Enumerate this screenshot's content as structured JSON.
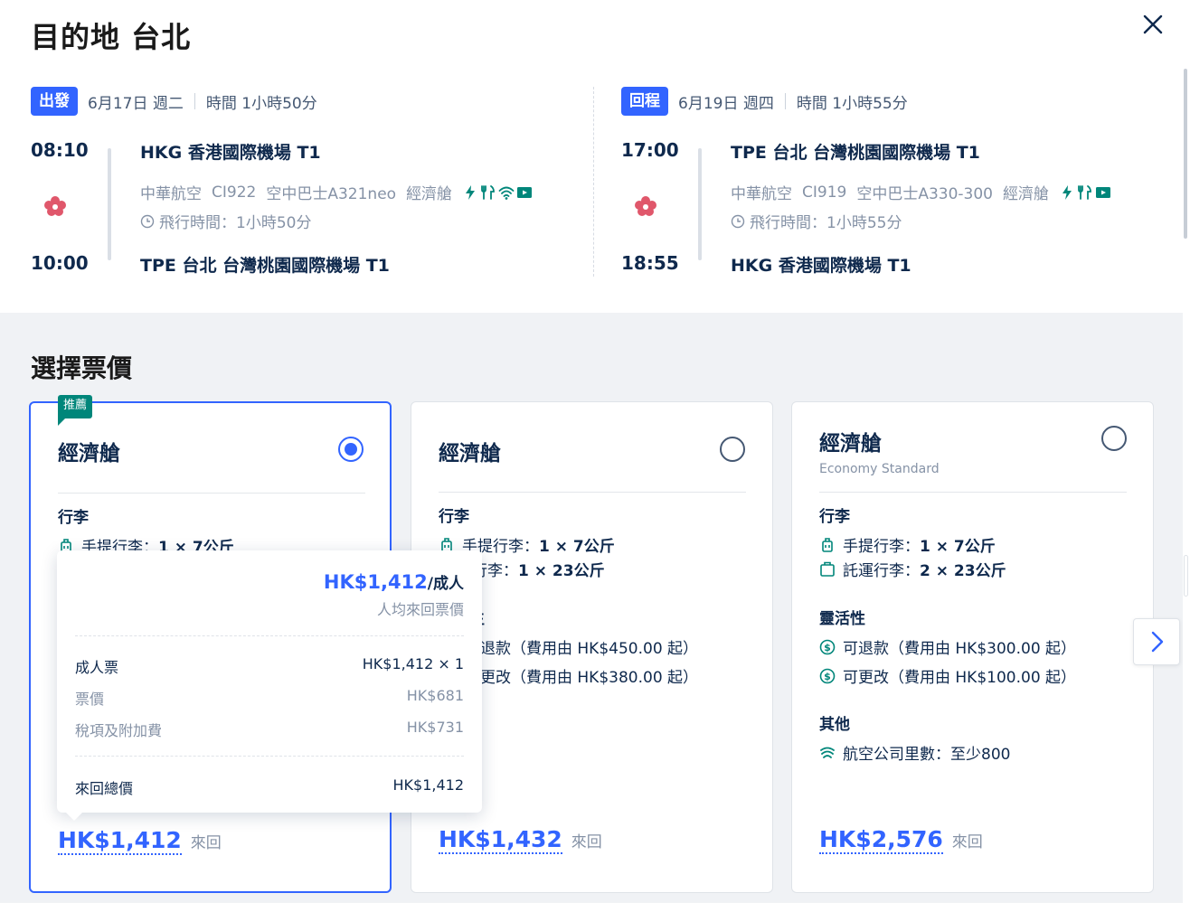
{
  "header": {
    "title": "目的地 台北",
    "close_icon": "close-icon"
  },
  "outbound": {
    "badge": "出發",
    "date": "6月17日 週二",
    "duration": "時間 1小時50分",
    "dep_time": "08:10",
    "arr_time": "10:00",
    "dep_airport": "HKG 香港國際機場 T1",
    "arr_airport": "TPE 台北 台灣桃園國際機場 T1",
    "airline": "中華航空",
    "flight_no": "CI922",
    "aircraft": "空中巴士A321neo",
    "cabin": "經濟艙",
    "flight_time": "飛行時間：1小時50分",
    "amenities": [
      "power-icon",
      "meal-icon",
      "wifi-icon",
      "entertainment-icon"
    ]
  },
  "inbound": {
    "badge": "回程",
    "date": "6月19日 週四",
    "duration": "時間 1小時55分",
    "dep_time": "17:00",
    "arr_time": "18:55",
    "dep_airport": "TPE 台北 台灣桃園國際機場 T1",
    "arr_airport": "HKG 香港國際機場 T1",
    "airline": "中華航空",
    "flight_no": "CI919",
    "aircraft": "空中巴士A330-300",
    "cabin": "經濟艙",
    "flight_time": "飛行時間：1小時55分",
    "amenities": [
      "power-icon",
      "meal-icon",
      "entertainment-icon"
    ]
  },
  "fares": {
    "section_title": "選擇票價",
    "recommended_badge": "推薦",
    "cards": [
      {
        "name": "經濟艙",
        "subtitle": "",
        "selected": true,
        "baggage_label": "行李",
        "carry_on_label": "手提行李：",
        "carry_on_value": "1 × 7公斤",
        "price": "HK$1,412",
        "price_unit": "來回"
      },
      {
        "name": "經濟艙",
        "subtitle": "",
        "selected": false,
        "baggage_label": "行李",
        "carry_on_label": "手提行李：",
        "carry_on_value": "1 × 7公斤",
        "checked_label_partial": "運行李：",
        "checked_value": "1 × 23公斤",
        "flex_label_partial": "生",
        "refund_partial": "退款（費用由 HK$450.00 起）",
        "change_partial": "更改（費用由 HK$380.00 起）",
        "price": "HK$1,432",
        "price_unit": "來回"
      },
      {
        "name": "經濟艙",
        "subtitle": "Economy Standard",
        "selected": false,
        "baggage_label": "行李",
        "carry_on_label": "手提行李：",
        "carry_on_value": "1 × 7公斤",
        "checked_label": "託運行李：",
        "checked_value": "2 × 23公斤",
        "flex_label": "靈活性",
        "refund": "可退款（費用由 HK$300.00 起）",
        "change": "可更改（費用由 HK$100.00 起）",
        "other_label": "其他",
        "miles_label": "航空公司里數：",
        "miles_value": "至少800",
        "price": "HK$2,576",
        "price_unit": "來回"
      }
    ]
  },
  "popover": {
    "price": "HK$1,412",
    "unit": "/成人",
    "note": "人均來回票價",
    "adult_label": "成人票",
    "adult_value": "HK$1,412 × 1",
    "fare_label": "票價",
    "fare_value": "HK$681",
    "tax_label": "稅項及附加費",
    "tax_value": "HK$731",
    "total_label": "來回總價",
    "total_value": "HK$1,412"
  },
  "colors": {
    "accent": "#3264ff",
    "text": "#0f294d",
    "muted": "#8592a6",
    "teal": "#00867a",
    "background": "#f0f2f5"
  }
}
